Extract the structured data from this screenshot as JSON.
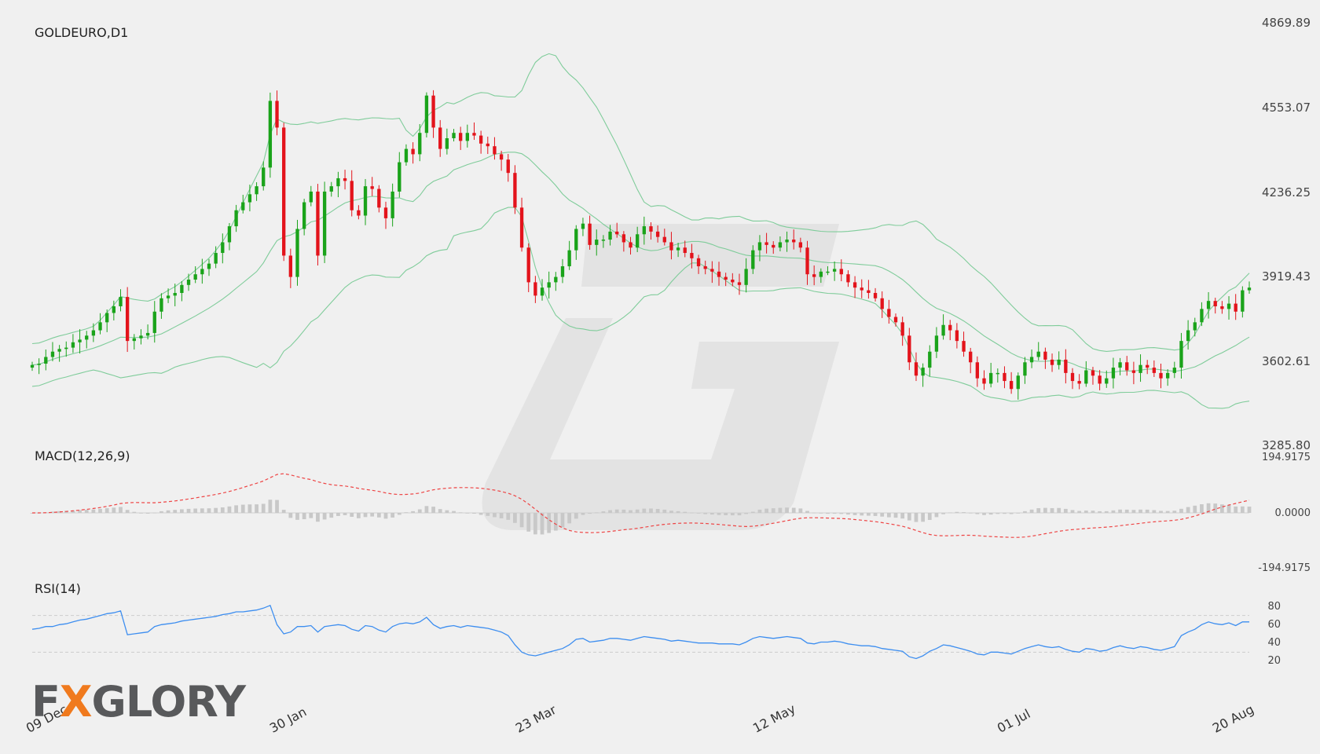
{
  "title": "GOLDEURO,D1",
  "logo": {
    "prefix": "F",
    "accent": "X",
    "suffix": "GLORY",
    "text": "FXGLORY"
  },
  "colors": {
    "bull": "#1aa31a",
    "bear": "#e3131b",
    "band": "#7fcc9a",
    "macd_signal": "#ee4444",
    "macd_hist": "#c8c8c8",
    "rsi": "#3d8ef0",
    "watermark": "#dcdcdc"
  },
  "chart_data": [
    {
      "type": "candlestick",
      "title": "GOLDEURO,D1",
      "ylim": [
        3285.8,
        4869.89
      ],
      "y_ticks": [
        "4869.89",
        "4553.07",
        "4236.25",
        "3919.43",
        "3602.61",
        "3285.80"
      ],
      "x_ticks": [
        {
          "label": "09 Dec",
          "index": 0
        },
        {
          "label": "30 Jan",
          "index": 36
        },
        {
          "label": "23 Mar",
          "index": 72
        },
        {
          "label": "12 May",
          "index": 107
        },
        {
          "label": "01 Jul",
          "index": 143
        },
        {
          "label": "20 Aug",
          "index": 179
        }
      ],
      "close_series": [
        3590,
        3595,
        3620,
        3640,
        3650,
        3655,
        3675,
        3685,
        3700,
        3720,
        3750,
        3785,
        3810,
        3845,
        3680,
        3690,
        3700,
        3710,
        3790,
        3840,
        3850,
        3860,
        3890,
        3910,
        3930,
        3950,
        3970,
        4010,
        4050,
        4110,
        4170,
        4200,
        4230,
        4260,
        4330,
        4580,
        4480,
        4000,
        3920,
        4100,
        4200,
        4240,
        4000,
        4240,
        4260,
        4290,
        4280,
        4170,
        4150,
        4260,
        4250,
        4180,
        4140,
        4240,
        4350,
        4400,
        4380,
        4460,
        4600,
        4480,
        4400,
        4440,
        4460,
        4430,
        4460,
        4450,
        4420,
        4410,
        4380,
        4360,
        4310,
        4180,
        4030,
        3900,
        3850,
        3880,
        3900,
        3920,
        3960,
        4020,
        4100,
        4120,
        4040,
        4060,
        4060,
        4090,
        4080,
        4050,
        4030,
        4080,
        4110,
        4090,
        4070,
        4050,
        4020,
        4030,
        4010,
        3990,
        3960,
        3950,
        3940,
        3920,
        3910,
        3900,
        3890,
        3950,
        4020,
        4050,
        4040,
        4030,
        4050,
        4060,
        4050,
        4030,
        3930,
        3920,
        3940,
        3940,
        3950,
        3930,
        3900,
        3880,
        3870,
        3860,
        3840,
        3800,
        3770,
        3750,
        3700,
        3600,
        3550,
        3580,
        3640,
        3700,
        3740,
        3720,
        3680,
        3640,
        3600,
        3540,
        3520,
        3560,
        3560,
        3530,
        3500,
        3550,
        3600,
        3620,
        3640,
        3610,
        3590,
        3610,
        3560,
        3530,
        3520,
        3570,
        3550,
        3520,
        3540,
        3580,
        3600,
        3570,
        3560,
        3590,
        3580,
        3560,
        3540,
        3560,
        3580,
        3680,
        3720,
        3750,
        3800,
        3830,
        3810,
        3800,
        3820,
        3790,
        3870,
        3880
      ]
    },
    {
      "type": "line",
      "title": "MACD(12,26,9)",
      "ylim": [
        -194.9175,
        194.9175
      ],
      "y_ticks": [
        "194.9175",
        "0.0000",
        "-194.9175"
      ]
    },
    {
      "type": "line",
      "title": "RSI(14)",
      "ylim": [
        0,
        100
      ],
      "y_ticks": [
        "80",
        "60",
        "40",
        "20"
      ],
      "series": [
        {
          "values": [
            55,
            56,
            58,
            58,
            60,
            61,
            63,
            65,
            66,
            68,
            70,
            72,
            73,
            75,
            49,
            50,
            51,
            52,
            58,
            60,
            61,
            62,
            64,
            65,
            66,
            67,
            68,
            69,
            71,
            72,
            74,
            74,
            75,
            76,
            78,
            81,
            60,
            50,
            52,
            58,
            58,
            59,
            52,
            58,
            59,
            60,
            59,
            55,
            53,
            59,
            58,
            54,
            52,
            58,
            61,
            62,
            61,
            63,
            68,
            60,
            56,
            58,
            59,
            57,
            59,
            58,
            57,
            56,
            54,
            52,
            48,
            38,
            30,
            27,
            26,
            28,
            30,
            32,
            34,
            38,
            44,
            45,
            41,
            42,
            43,
            45,
            45,
            44,
            43,
            45,
            47,
            46,
            45,
            44,
            42,
            43,
            42,
            41,
            40,
            40,
            40,
            39,
            39,
            39,
            38,
            41,
            45,
            47,
            46,
            45,
            46,
            47,
            46,
            45,
            40,
            39,
            41,
            41,
            42,
            41,
            39,
            38,
            37,
            37,
            36,
            34,
            33,
            32,
            31,
            25,
            23,
            26,
            31,
            34,
            38,
            37,
            35,
            33,
            31,
            28,
            27,
            30,
            30,
            29,
            28,
            31,
            34,
            36,
            38,
            36,
            35,
            36,
            33,
            31,
            30,
            34,
            33,
            31,
            32,
            35,
            37,
            35,
            34,
            36,
            35,
            33,
            32,
            34,
            36,
            48,
            52,
            55,
            60,
            63,
            61,
            60,
            62,
            59,
            63,
            63
          ]
        }
      ]
    }
  ]
}
